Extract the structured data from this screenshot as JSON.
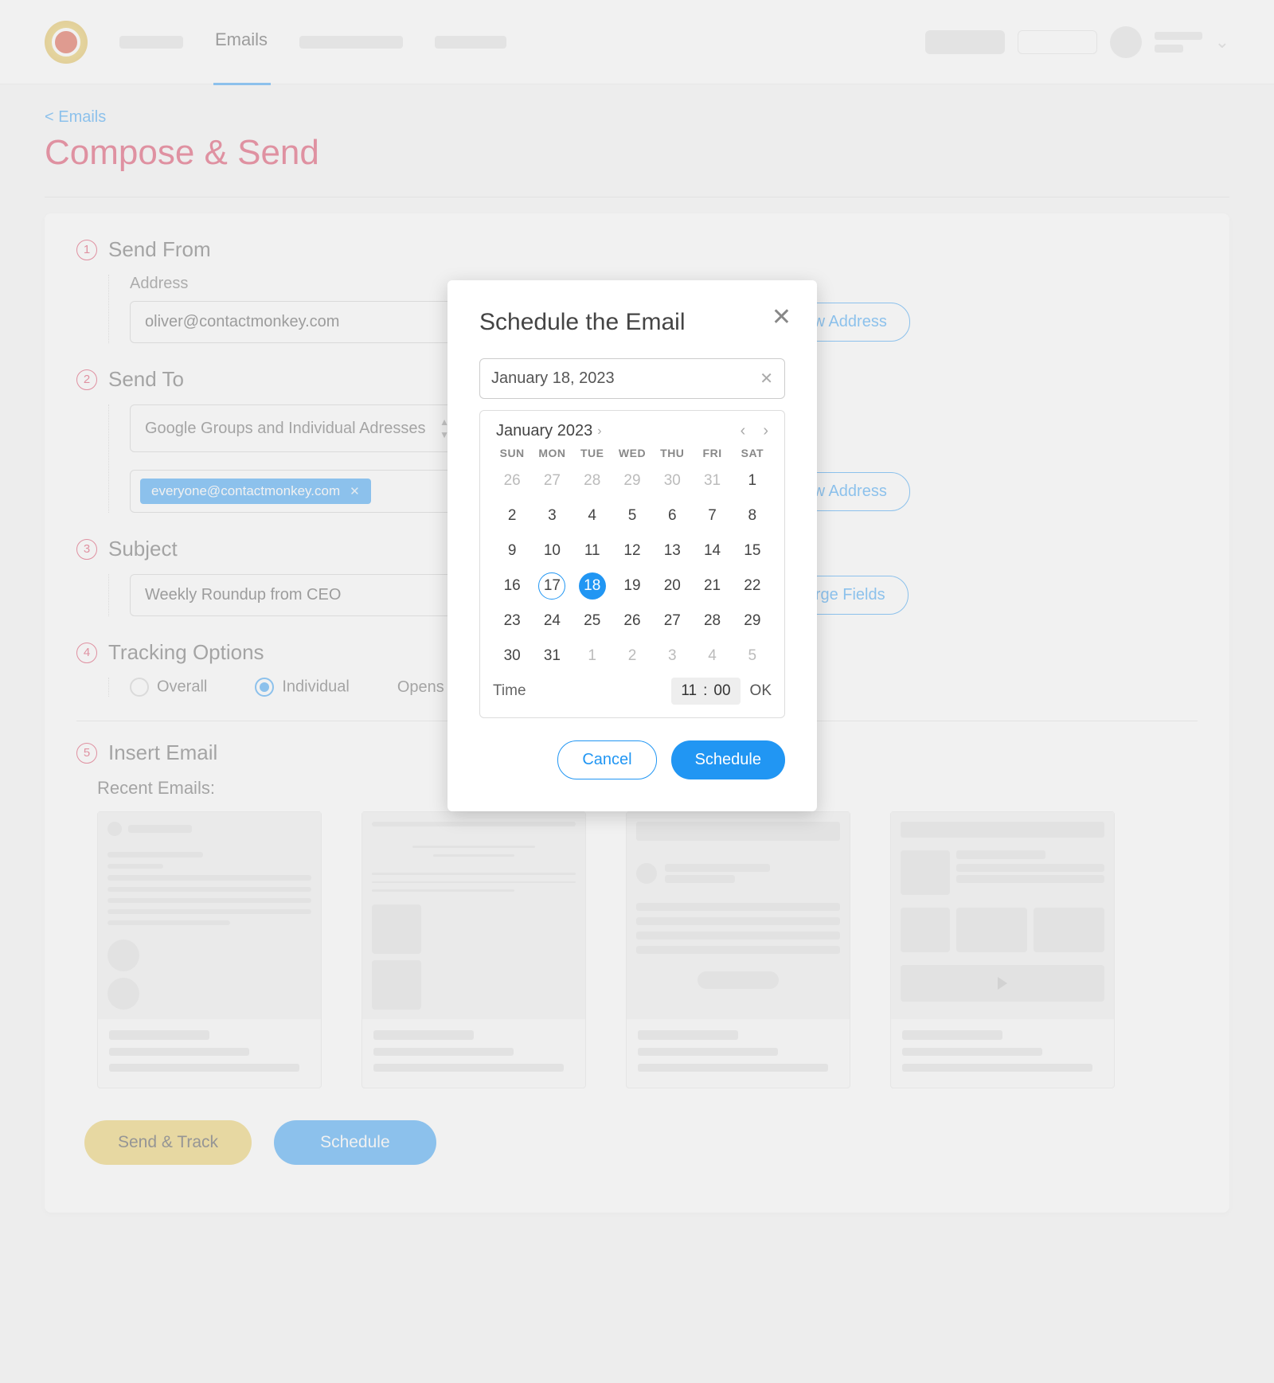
{
  "header": {
    "nav_active": "Emails"
  },
  "breadcrumb": "< Emails",
  "page_title": "Compose & Send",
  "steps": {
    "s1": {
      "num": "1",
      "title": "Send From",
      "address_label": "Address",
      "address_value": "oliver@contactmonkey.com",
      "new_address_btn": "New Address"
    },
    "s2": {
      "num": "2",
      "title": "Send To",
      "select_label": "Google Groups and Individual Adresses",
      "chip": "everyone@contactmonkey.com",
      "new_address_btn": "New Address"
    },
    "s3": {
      "num": "3",
      "title": "Subject",
      "value": "Weekly Roundup from CEO",
      "merge_btn": "Merge Fields"
    },
    "s4": {
      "num": "4",
      "title": "Tracking Options",
      "overall": "Overall",
      "individual": "Individual",
      "opens": "Opens"
    },
    "s5": {
      "num": "5",
      "title": "Insert Email",
      "recent": "Recent Emails:"
    }
  },
  "actions": {
    "send": "Send & Track",
    "schedule": "Schedule"
  },
  "modal": {
    "title": "Schedule the Email",
    "date_value": "January 18, 2023",
    "month_label": "January 2023",
    "weekdays": [
      "SUN",
      "MON",
      "TUE",
      "WED",
      "THU",
      "FRI",
      "SAT"
    ],
    "rows": [
      [
        {
          "d": "26",
          "o": true
        },
        {
          "d": "27",
          "o": true
        },
        {
          "d": "28",
          "o": true
        },
        {
          "d": "29",
          "o": true
        },
        {
          "d": "30",
          "o": true
        },
        {
          "d": "31",
          "o": true
        },
        {
          "d": "1"
        }
      ],
      [
        {
          "d": "2"
        },
        {
          "d": "3"
        },
        {
          "d": "4"
        },
        {
          "d": "5"
        },
        {
          "d": "6"
        },
        {
          "d": "7"
        },
        {
          "d": "8"
        }
      ],
      [
        {
          "d": "9"
        },
        {
          "d": "10"
        },
        {
          "d": "11"
        },
        {
          "d": "12"
        },
        {
          "d": "13"
        },
        {
          "d": "14"
        },
        {
          "d": "15"
        }
      ],
      [
        {
          "d": "16"
        },
        {
          "d": "17",
          "today": true
        },
        {
          "d": "18",
          "sel": true
        },
        {
          "d": "19"
        },
        {
          "d": "20"
        },
        {
          "d": "21"
        },
        {
          "d": "22"
        }
      ],
      [
        {
          "d": "23"
        },
        {
          "d": "24"
        },
        {
          "d": "25"
        },
        {
          "d": "26"
        },
        {
          "d": "27"
        },
        {
          "d": "28"
        },
        {
          "d": "29"
        }
      ],
      [
        {
          "d": "30"
        },
        {
          "d": "31"
        },
        {
          "d": "1",
          "o": true
        },
        {
          "d": "2",
          "o": true
        },
        {
          "d": "3",
          "o": true
        },
        {
          "d": "4",
          "o": true
        },
        {
          "d": "5",
          "o": true
        }
      ]
    ],
    "time_label": "Time",
    "time_h": "11",
    "time_m": "00",
    "ok": "OK",
    "cancel": "Cancel",
    "schedule": "Schedule"
  }
}
